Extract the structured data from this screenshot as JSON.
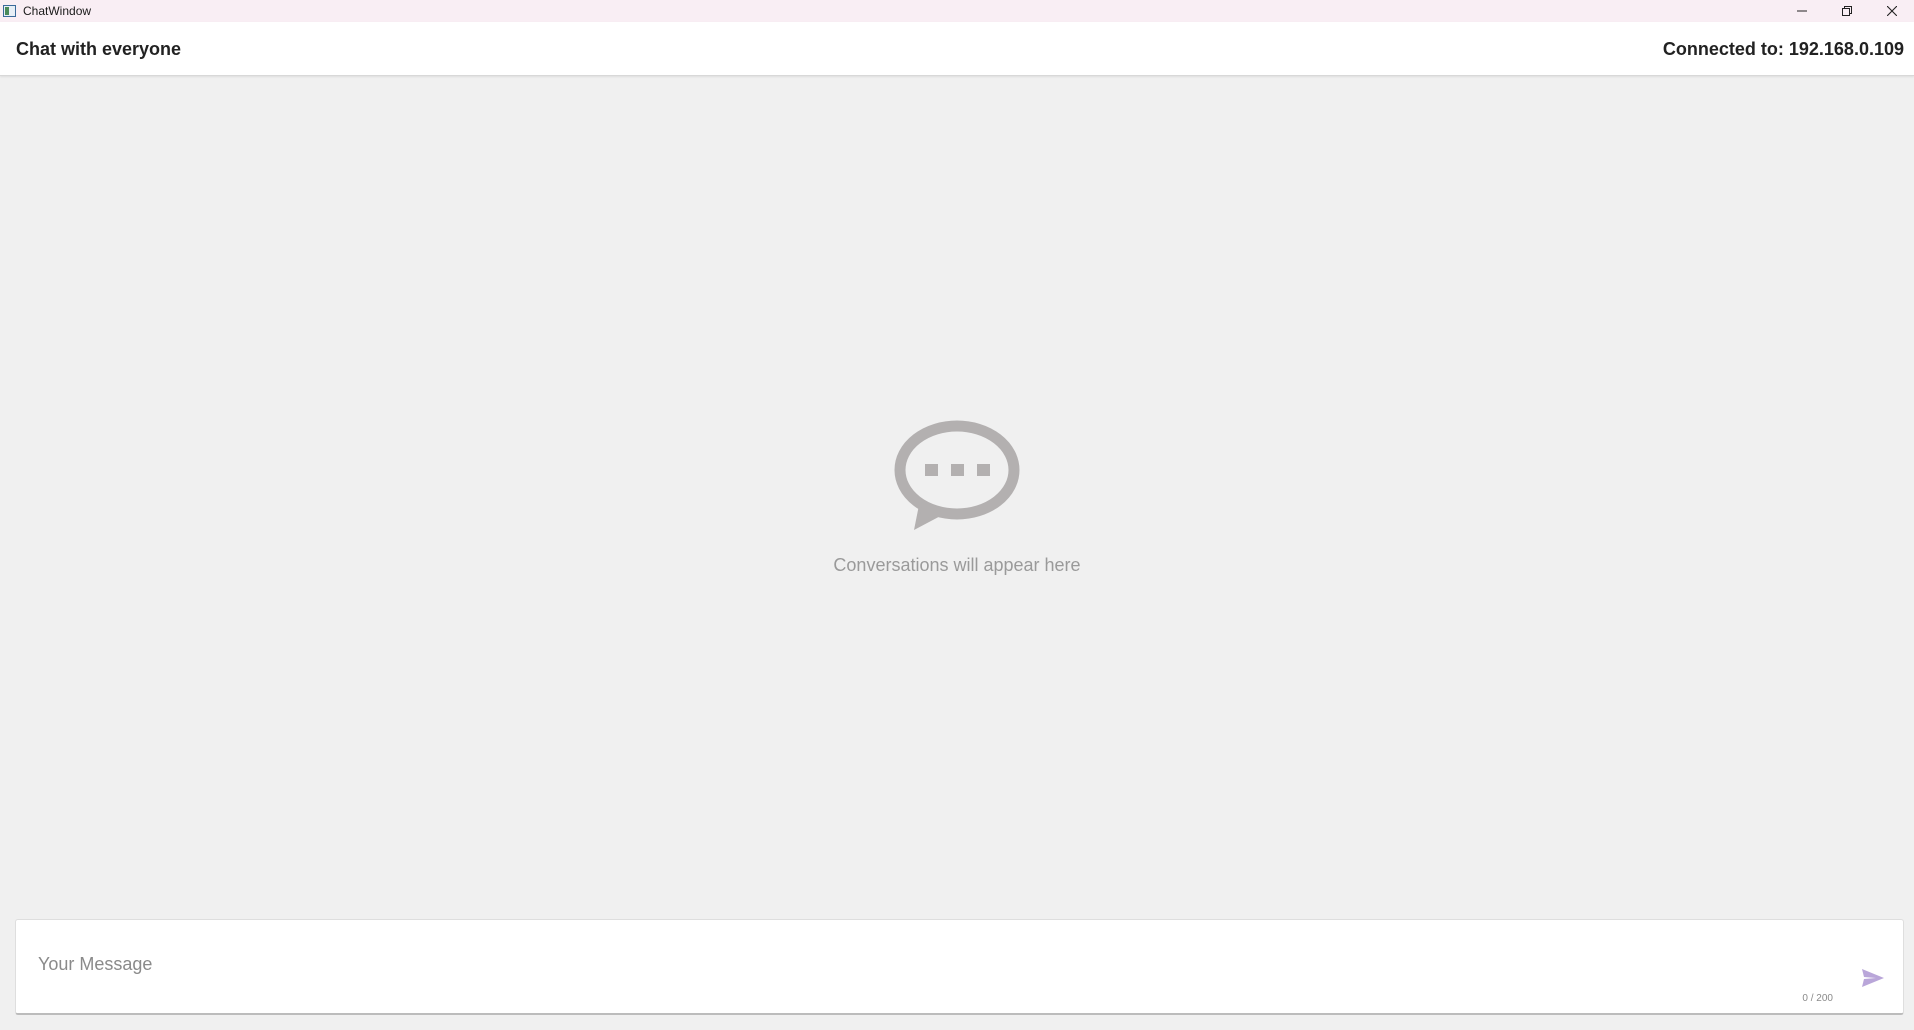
{
  "window": {
    "title": "ChatWindow",
    "controls": [
      "minimize-icon",
      "restore-icon",
      "close-icon"
    ]
  },
  "header": {
    "title": "Chat with everyone",
    "status": "Connected to: 192.168.0.109"
  },
  "empty_state": {
    "icon": "chat-bubble-icon",
    "text": "Conversations will appear here"
  },
  "composer": {
    "value": "",
    "placeholder": "Your Message",
    "counter": "0 / 200",
    "send_icon": "send-icon"
  },
  "colors": {
    "titlebar_bg": "#f9eef4",
    "app_bg": "#f0f0f0",
    "icon_gray": "#b3b0b0",
    "send_accent": "#b9a6d9"
  }
}
